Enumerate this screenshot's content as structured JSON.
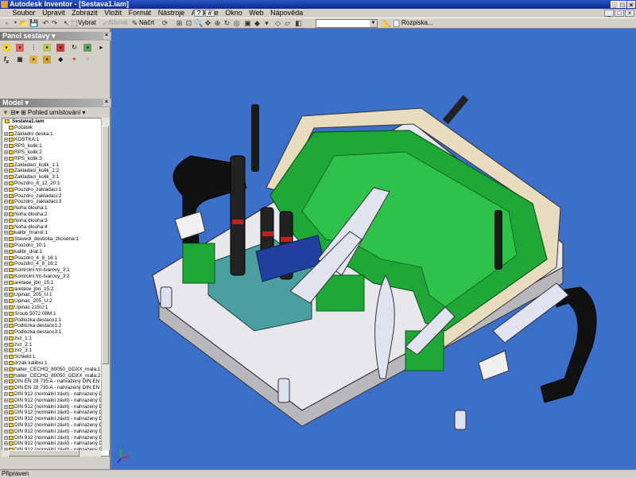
{
  "window": {
    "title": "Autodesk Inventor - [Sestava1.iam]"
  },
  "menu": {
    "items": [
      "Soubor",
      "Úpravit",
      "Zobrazit",
      "Vložit",
      "Formát",
      "Nástroje",
      "Aplikace",
      "Okno",
      "Web",
      "Nápověda"
    ]
  },
  "toolbar": {
    "select_label": "Vybrat",
    "return_label": "Návrat",
    "sketch_label": "Náčrt",
    "style_value": "",
    "section_label": "Rozpiska..."
  },
  "panels": {
    "assembly_panel_title": "Panel sestavy",
    "model_title": "Model",
    "model_filter_label": "Pohled umístování"
  },
  "tree": {
    "root": "Sestava1.iam",
    "items": [
      "Počátek",
      "Základní deska:1",
      "KOSTKA:1",
      "RPS_kolik:1",
      "RPS_kolik:2",
      "RPS_kolik:3",
      "Zakladaci_kolik_1:1",
      "Zakladaci_kolik_1:2",
      "Zakladaci_kolik_3:1",
      "Pouzdro_8_12_20:1",
      "Pouzdro_zakladaci:1",
      "Pouzdro_zakladaci:2",
      "Pouzdro_zakladaci:3",
      "Noha dlouha:1",
      "Noha dlouha:2",
      "Noha dlouha:3",
      "Noha dlouha:4",
      "kalibr_hranol:1",
      "Stavedi_desticka_zkosena:1",
      "Pouzdro_10:1",
      "kalibr_drat:1",
      "Pouzdro_4_8_16:1",
      "Pouzdro_4_8_16:2",
      "Kontrolni trn-tvarovy_3:1",
      "Kontrolni trn-tvarovy_3:2",
      "aretace_jbn_15:1",
      "aretace_jbn_15:2",
      "Upinac_205_U:1",
      "Upinac_205_U:2",
      "Upinac 215U:1",
      "Sroub 5072 08M:1",
      "Podlozka destaco1:1",
      "Podlozka destaco1:2",
      "Podlozka destaco3:1",
      "zvz_1:1",
      "zvz_2:1",
      "zvz_3:1",
      "Schield:1",
      "drzak kalibru:1",
      "halter_CECHO_80050_GDXX_mala:1",
      "halter_CECHO_80050_GDXX_mala:2",
      "DIN EN 28 735  A - nahrazený DIN EN I",
      "DIN EN 28 735  A - nahrazený DIN EN I",
      "DIN 912  (normální závit) - nahrazený D",
      "DIN 912  (normální závit) - nahrazený D",
      "DIN 912  (normální závit) - nahrazený D",
      "DIN 912  (normální závit) - nahrazený D",
      "DIN 912  (normální závit) - nahrazený D",
      "DIN 912  (normální závit) - nahrazený D",
      "DIN 912  (normální závit) - nahrazený D",
      "DIN 912  (normální závit) - nahrazený D",
      "DIN 912  (normální závit) - nahrazený D",
      "DIN 912  (normální závit) - nahrazený D"
    ]
  },
  "status": {
    "text": "Připraven"
  },
  "colors": {
    "viewport_bg": "#3b6fc9",
    "title_bg": "#0a2a8e",
    "fixture_green": "#1fa838"
  }
}
